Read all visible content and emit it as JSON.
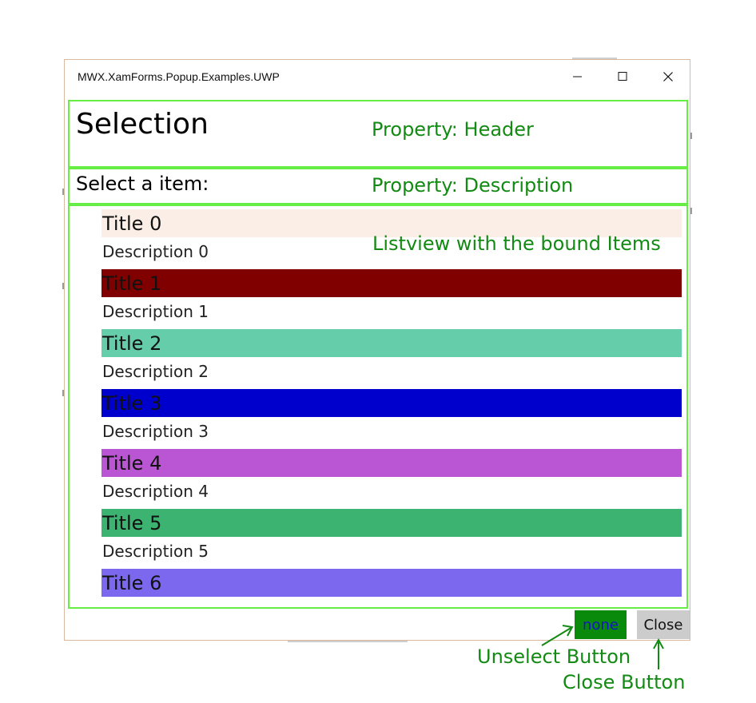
{
  "window": {
    "app_title": "MWX.XamForms.Popup.Examples.UWP"
  },
  "popup": {
    "header": "Selection",
    "description": "Select a item:",
    "items": [
      {
        "title": "Title 0",
        "description": "Description 0",
        "color": "#faeee6"
      },
      {
        "title": "Title 1",
        "description": "Description 1",
        "color": "#800000"
      },
      {
        "title": "Title 2",
        "description": "Description 2",
        "color": "#66cdaa"
      },
      {
        "title": "Title 3",
        "description": "Description 3",
        "color": "#0000cd"
      },
      {
        "title": "Title 4",
        "description": "Description 4",
        "color": "#ba55d3"
      },
      {
        "title": "Title 5",
        "description": "Description 5",
        "color": "#3cb371"
      },
      {
        "title": "Title 6",
        "description": "",
        "color": "#7b68ee"
      }
    ],
    "buttons": {
      "unselect_label": "none",
      "close_label": "Close"
    }
  },
  "annotations": {
    "header_property": "Property: Header",
    "description_property": "Property: Description",
    "listview_note": "Listview with the bound Items",
    "unselect_button": "Unselect Button",
    "close_button": "Close Button"
  },
  "colors": {
    "annotation_green": "#138a13",
    "outline_green": "#66ee44",
    "unselect_button_bg": "#0a8a0a",
    "close_button_bg": "#cccccc"
  }
}
